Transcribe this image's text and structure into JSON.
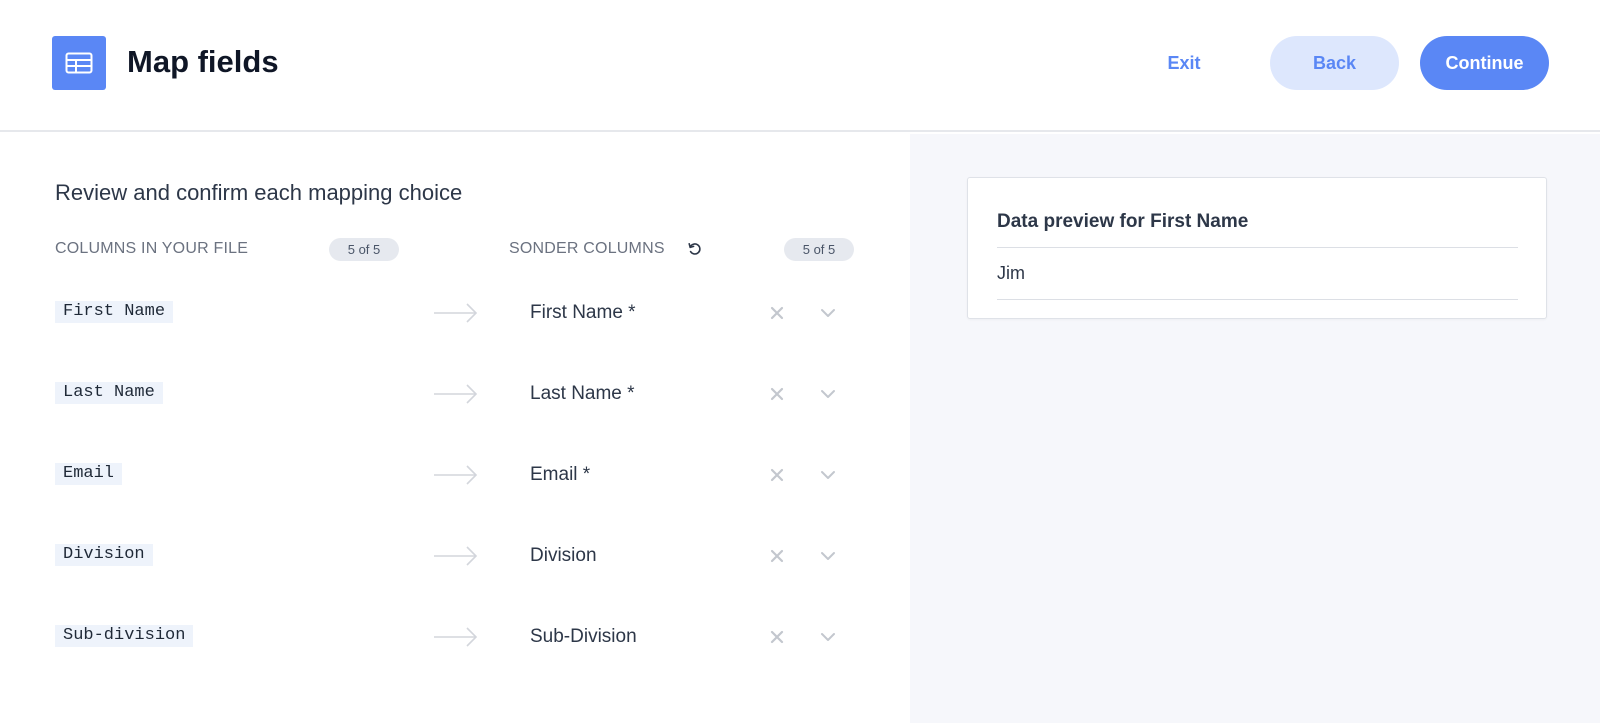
{
  "header": {
    "title": "Map fields",
    "exit_label": "Exit",
    "back_label": "Back",
    "continue_label": "Continue"
  },
  "mapping": {
    "subtitle": "Review and confirm each mapping choice",
    "file_columns_header": "COLUMNS IN YOUR FILE",
    "file_columns_count": "5 of 5",
    "sonder_columns_header": "SONDER COLUMNS",
    "sonder_columns_count": "5 of 5",
    "rows": [
      {
        "source": "First Name",
        "target": "First Name *"
      },
      {
        "source": "Last Name",
        "target": "Last Name *"
      },
      {
        "source": "Email",
        "target": "Email *"
      },
      {
        "source": "Division",
        "target": "Division"
      },
      {
        "source": "Sub-division",
        "target": "Sub-Division"
      }
    ]
  },
  "preview": {
    "title": "Data preview for First Name",
    "values": [
      "Jim"
    ]
  },
  "colors": {
    "accent": "#5a87f5",
    "accent_light": "#dde7fd",
    "preview_bg": "#f6f7fb"
  },
  "icons": {
    "app": "table-icon",
    "reset": "reset-icon",
    "arrow": "arrow-right-icon",
    "clear": "close-icon",
    "dropdown": "chevron-down-icon"
  }
}
